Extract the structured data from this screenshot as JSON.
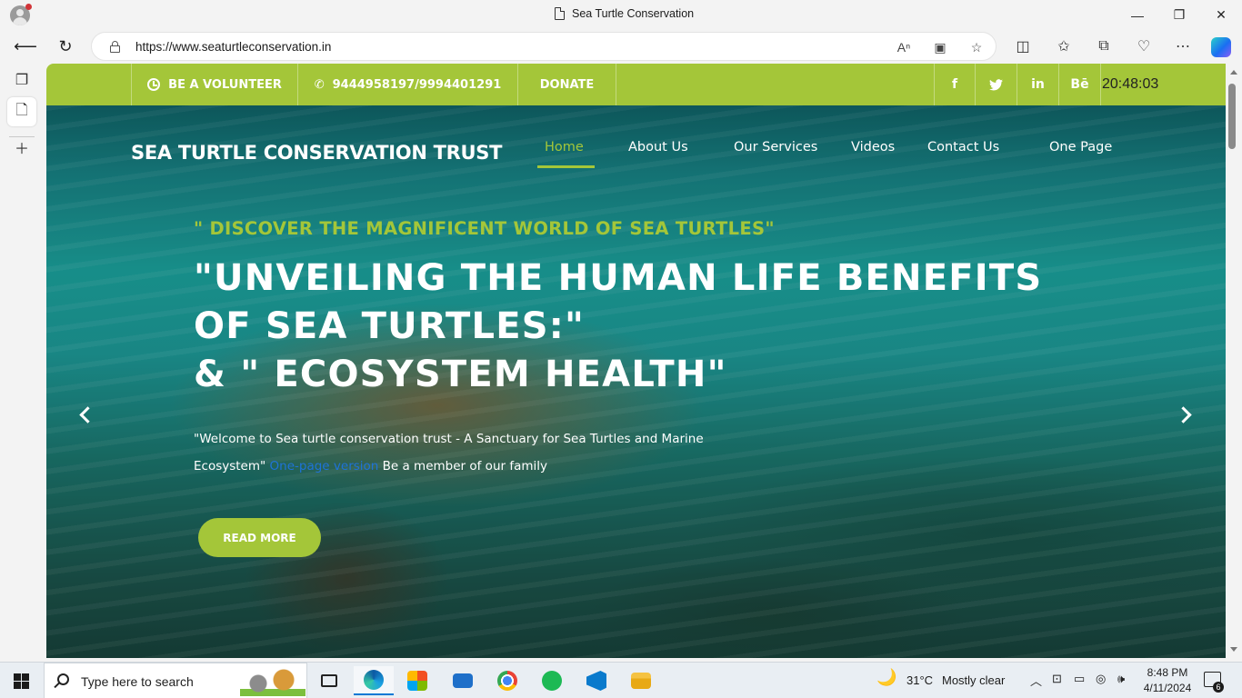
{
  "browser": {
    "tab_title": "Sea Turtle Conservation",
    "url": "https://www.seaturtleconservation.in",
    "window_controls": {
      "minimize": "—",
      "maximize": "❐",
      "close": "✕"
    }
  },
  "site": {
    "topbar": {
      "volunteer": "BE A VOLUNTEER",
      "phone": "9444958197/9994401291",
      "donate": "DONATE",
      "social": {
        "facebook": "f",
        "twitter": "🐦",
        "linkedin": "in",
        "behance": "Bē"
      },
      "time": "20:48:03"
    },
    "brand": "SEA TURTLE CONSERVATION TRUST",
    "nav": {
      "home": "Home",
      "about": "About Us",
      "services": "Our Services",
      "videos": "Videos",
      "contact": "Contact Us",
      "one_page": "One Page"
    },
    "hero": {
      "tagline": "\" DISCOVER THE MAGNIFICENT WORLD OF SEA TURTLES\"",
      "headline_line1": "\"UNVEILING THE HUMAN LIFE BENEFITS",
      "headline_line2": "OF SEA TURTLES:\"",
      "headline_line3": "& \" ECOSYSTEM HEALTH\"",
      "intro_before": "\"Welcome to Sea turtle conservation trust - A Sanctuary for Sea Turtles and Marine Ecosystem\"",
      "intro_link": "One-page version",
      "intro_after": " Be a member of our family",
      "read_more": "READ MORE"
    }
  },
  "taskbar": {
    "search_placeholder": "Type here to search",
    "weather_temp": "31°C",
    "weather_desc": "Mostly clear",
    "time": "8:48 PM",
    "date": "4/11/2024",
    "notification_count": "6"
  },
  "colors": {
    "accent": "#a4c639",
    "link": "#1e73d8"
  }
}
